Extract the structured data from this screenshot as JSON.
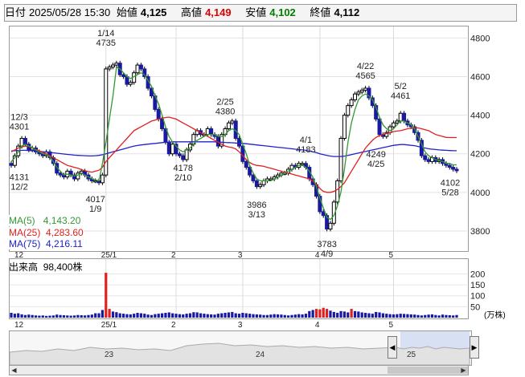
{
  "header": {
    "date_label": "日付",
    "datetime": "2025/05/28 15:30",
    "open_label": "始値",
    "open": "4,125",
    "high_label": "高値",
    "high": "4,149",
    "low_label": "安値",
    "low": "4,102",
    "close_label": "終値",
    "close": "4,112"
  },
  "ma": {
    "ma5_label": "MA(5)",
    "ma5": "4,143.20",
    "ma25_label": "MA(25)",
    "ma25": "4,283.60",
    "ma75_label": "MA(75)",
    "ma75": "4,216.11"
  },
  "volume": {
    "label": "出来高",
    "value": "98,400株",
    "unit": "(万株)"
  },
  "colors": {
    "up": "#000000",
    "down": "#1a1aa0",
    "ma5": "#339933",
    "ma25": "#e02020",
    "ma75": "#2020cc",
    "volume": "#1a1aa0",
    "volume_hi": "#e02020"
  },
  "navigator": {
    "year_labels": [
      "23",
      "24",
      "25"
    ]
  },
  "chart_data": {
    "type": "candlestick",
    "price_axis": {
      "ticks": [
        3800,
        4000,
        4200,
        4400,
        4600,
        4800
      ],
      "ylim": [
        3700,
        4860
      ]
    },
    "volume_axis": {
      "ticks": [
        50,
        100,
        150,
        200
      ],
      "ylim": [
        0,
        220
      ]
    },
    "month_labels": [
      "12",
      "25/1",
      "2",
      "3",
      "4",
      "5"
    ],
    "annotations": [
      {
        "date": "12/3",
        "value": 4301,
        "pos": "above"
      },
      {
        "date": "12/2",
        "value": 4131,
        "pos": "below"
      },
      {
        "date": "1/14",
        "value": 4735,
        "pos": "above"
      },
      {
        "date": "1/9",
        "value": 4017,
        "pos": "below"
      },
      {
        "date": "2/10",
        "value": 4178,
        "pos": "below"
      },
      {
        "date": "2/25",
        "value": 4380,
        "pos": "above"
      },
      {
        "date": "3/13",
        "value": 3986,
        "pos": "below"
      },
      {
        "date": "4/1",
        "value": 4183,
        "pos": "above"
      },
      {
        "date": "4/9",
        "value": 3783,
        "pos": "below"
      },
      {
        "date": "4/22",
        "value": 4565,
        "pos": "above"
      },
      {
        "date": "4/25",
        "value": 4249,
        "pos": "below"
      },
      {
        "date": "5/2",
        "value": 4461,
        "pos": "above"
      },
      {
        "date": "5/28",
        "value": 4102,
        "pos": "below"
      }
    ],
    "closes": [
      4140,
      4190,
      4240,
      4280,
      4250,
      4220,
      4230,
      4210,
      4200,
      4190,
      4210,
      4180,
      4150,
      4100,
      4090,
      4080,
      4110,
      4090,
      4070,
      4100,
      4110,
      4090,
      4070,
      4060,
      4060,
      4050,
      4090,
      4640,
      4650,
      4660,
      4670,
      4610,
      4600,
      4560,
      4570,
      4620,
      4660,
      4640,
      4600,
      4540,
      4500,
      4430,
      4380,
      4330,
      4260,
      4200,
      4250,
      4200,
      4190,
      4170,
      4220,
      4250,
      4300,
      4320,
      4300,
      4300,
      4330,
      4300,
      4290,
      4240,
      4300,
      4330,
      4360,
      4370,
      4280,
      4240,
      4160,
      4130,
      4090,
      4060,
      4030,
      4040,
      4060,
      4070,
      4070,
      4080,
      4090,
      4100,
      4100,
      4120,
      4140,
      4130,
      4150,
      4150,
      4130,
      4070,
      4040,
      3980,
      3900,
      3880,
      3810,
      3840,
      3950,
      4060,
      4280,
      4400,
      4450,
      4480,
      4510,
      4520,
      4530,
      4540,
      4490,
      4450,
      4380,
      4300,
      4290,
      4310,
      4340,
      4360,
      4370,
      4410,
      4370,
      4350,
      4340,
      4310,
      4270,
      4190,
      4170,
      4160,
      4180,
      4160,
      4170,
      4150,
      4140,
      4130,
      4120,
      4112
    ],
    "ma5": [
      4160,
      4180,
      4210,
      4240,
      4250,
      4240,
      4230,
      4220,
      4210,
      4200,
      4195,
      4185,
      4160,
      4130,
      4110,
      4090,
      4095,
      4090,
      4085,
      4090,
      4100,
      4090,
      4080,
      4070,
      4065,
      4060,
      4150,
      4260,
      4380,
      4500,
      4650,
      4640,
      4620,
      4600,
      4590,
      4600,
      4610,
      4620,
      4610,
      4580,
      4550,
      4500,
      4460,
      4400,
      4340,
      4290,
      4260,
      4240,
      4220,
      4210,
      4220,
      4230,
      4250,
      4270,
      4280,
      4290,
      4300,
      4300,
      4300,
      4290,
      4290,
      4300,
      4320,
      4330,
      4320,
      4300,
      4250,
      4200,
      4140,
      4100,
      4070,
      4060,
      4060,
      4060,
      4060,
      4070,
      4080,
      4090,
      4100,
      4110,
      4120,
      4130,
      4140,
      4140,
      4130,
      4110,
      4080,
      4030,
      3970,
      3920,
      3870,
      3860,
      3880,
      3930,
      4000,
      4120,
      4260,
      4360,
      4430,
      4480,
      4500,
      4510,
      4500,
      4480,
      4440,
      4390,
      4350,
      4330,
      4320,
      4330,
      4350,
      4370,
      4370,
      4360,
      4350,
      4330,
      4290,
      4250,
      4210,
      4190,
      4180,
      4170,
      4165,
      4160,
      4150,
      4150,
      4143,
      4143
    ],
    "ma25": [
      4210,
      4220,
      4230,
      4235,
      4240,
      4238,
      4230,
      4222,
      4215,
      4208,
      4200,
      4190,
      4180,
      4170,
      4160,
      4150,
      4140,
      4135,
      4130,
      4125,
      4118,
      4112,
      4108,
      4105,
      4110,
      4115,
      4130,
      4160,
      4180,
      4200,
      4220,
      4240,
      4260,
      4280,
      4300,
      4320,
      4330,
      4340,
      4350,
      4360,
      4370,
      4375,
      4380,
      4385,
      4388,
      4390,
      4385,
      4380,
      4370,
      4360,
      4350,
      4340,
      4330,
      4320,
      4310,
      4300,
      4290,
      4280,
      4270,
      4260,
      4250,
      4240,
      4235,
      4232,
      4225,
      4210,
      4190,
      4170,
      4155,
      4145,
      4140,
      4138,
      4135,
      4130,
      4125,
      4120,
      4115,
      4110,
      4105,
      4100,
      4095,
      4090,
      4085,
      4080,
      4075,
      4070,
      4060,
      4040,
      4020,
      4005,
      4000,
      4000,
      4005,
      4015,
      4030,
      4050,
      4080,
      4110,
      4140,
      4170,
      4200,
      4230,
      4250,
      4270,
      4285,
      4295,
      4300,
      4305,
      4310,
      4315,
      4318,
      4320,
      4325,
      4330,
      4332,
      4335,
      4334,
      4330,
      4325,
      4320,
      4310,
      4300,
      4295,
      4290,
      4285,
      4284,
      4284,
      4284
    ],
    "ma75": [
      4215,
      4216,
      4217,
      4218,
      4218,
      4217,
      4216,
      4215,
      4213,
      4211,
      4209,
      4207,
      4205,
      4203,
      4201,
      4199,
      4197,
      4195,
      4193,
      4192,
      4191,
      4190,
      4189,
      4189,
      4190,
      4192,
      4195,
      4200,
      4205,
      4210,
      4215,
      4220,
      4225,
      4230,
      4235,
      4240,
      4243,
      4246,
      4248,
      4250,
      4252,
      4254,
      4256,
      4258,
      4260,
      4261,
      4262,
      4262,
      4262,
      4262,
      4262,
      4262,
      4262,
      4262,
      4262,
      4262,
      4262,
      4262,
      4262,
      4261,
      4260,
      4259,
      4258,
      4257,
      4256,
      4255,
      4254,
      4252,
      4250,
      4248,
      4246,
      4244,
      4242,
      4240,
      4238,
      4236,
      4234,
      4232,
      4230,
      4228,
      4226,
      4224,
      4222,
      4220,
      4218,
      4214,
      4210,
      4206,
      4200,
      4196,
      4192,
      4188,
      4186,
      4186,
      4186,
      4188,
      4192,
      4196,
      4200,
      4204,
      4208,
      4212,
      4216,
      4220,
      4224,
      4228,
      4232,
      4236,
      4240,
      4244,
      4246,
      4248,
      4248,
      4246,
      4244,
      4242,
      4238,
      4234,
      4230,
      4226,
      4224,
      4222,
      4220,
      4219,
      4218,
      4217,
      4216,
      4216
    ],
    "volume": [
      22,
      18,
      20,
      15,
      12,
      14,
      12,
      10,
      9,
      10,
      8,
      9,
      10,
      14,
      12,
      11,
      10,
      9,
      10,
      12,
      11,
      10,
      12,
      14,
      20,
      20,
      35,
      205,
      40,
      28,
      25,
      20,
      18,
      16,
      15,
      18,
      22,
      20,
      18,
      14,
      12,
      16,
      18,
      20,
      22,
      24,
      20,
      18,
      16,
      15,
      18,
      20,
      25,
      24,
      20,
      18,
      16,
      15,
      14,
      18,
      20,
      22,
      24,
      26,
      20,
      18,
      22,
      20,
      18,
      16,
      15,
      14,
      12,
      12,
      14,
      16,
      15,
      14,
      12,
      10,
      12,
      14,
      16,
      15,
      18,
      30,
      35,
      40,
      38,
      45,
      40,
      32,
      26,
      22,
      30,
      28,
      24,
      40,
      30,
      28,
      24,
      22,
      20,
      18,
      26,
      24,
      20,
      18,
      16,
      15,
      16,
      18,
      17,
      16,
      15,
      14,
      12,
      10,
      12,
      14,
      15,
      12,
      10,
      14,
      12,
      11,
      10,
      12
    ]
  }
}
